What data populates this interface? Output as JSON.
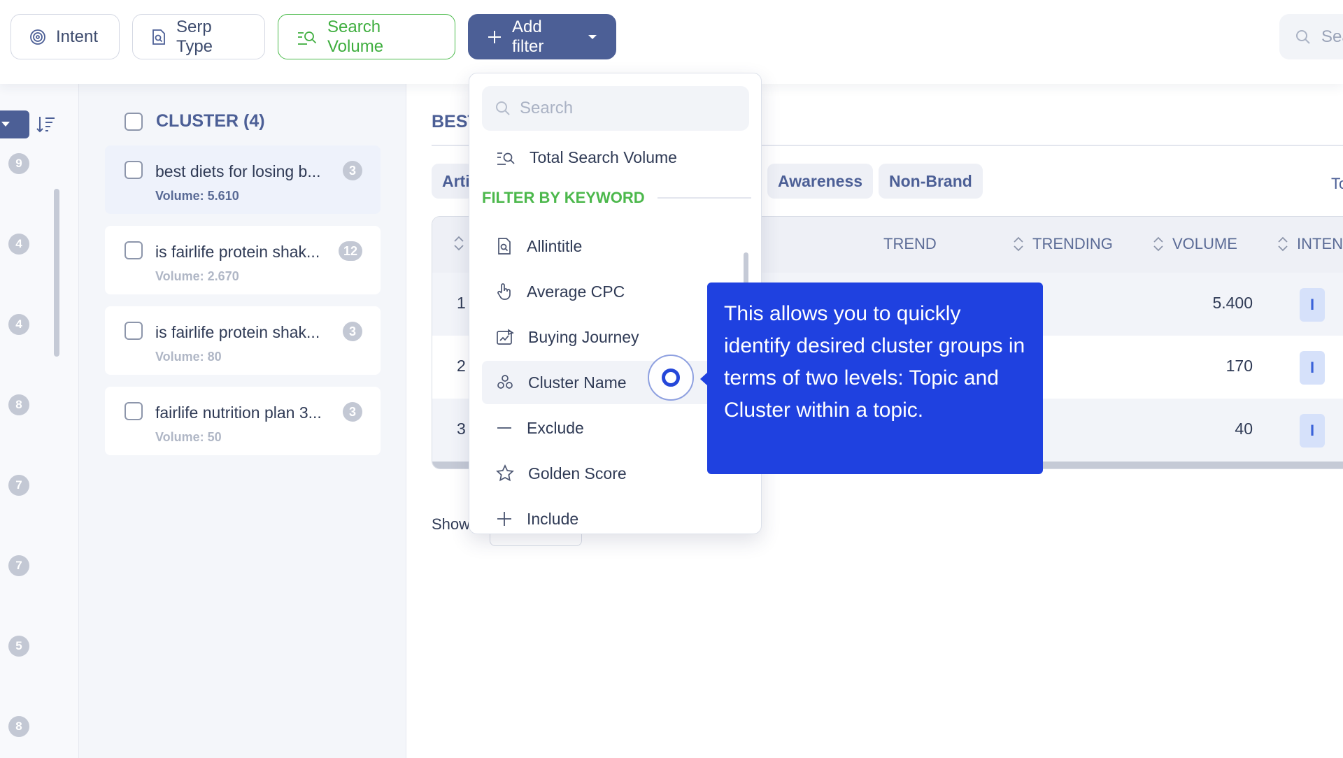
{
  "toolbar": {
    "intent_label": "Intent",
    "serp_type_label": "Serp Type",
    "search_volume_label": "Search Volume",
    "add_filter_label": "Add filter",
    "search_placeholder": "Sea"
  },
  "rail": {
    "numbers": [
      "9",
      "4",
      "4",
      "8",
      "7",
      "7",
      "5",
      "8"
    ]
  },
  "clusters": {
    "header": "CLUSTER (4)",
    "items": [
      {
        "title": "best diets for losing b...",
        "volume": "Volume: 5.610",
        "count": "3"
      },
      {
        "title": "is fairlife protein shak...",
        "volume": "Volume: 2.670",
        "count": "12"
      },
      {
        "title": "is fairlife protein shak...",
        "volume": "Volume: 80",
        "count": "3"
      },
      {
        "title": "fairlife nutrition plan 3...",
        "volume": "Volume: 50",
        "count": "3"
      }
    ]
  },
  "main": {
    "title_fragment": "BEST",
    "pill_left": "Arti",
    "pills": [
      "Awareness",
      "Non-Brand"
    ],
    "right_fragment": "To",
    "table": {
      "headers": {
        "trend": "TREND",
        "trending": "TRENDING",
        "volume": "VOLUME",
        "intent": "INTEN"
      },
      "rows": [
        {
          "num": "1",
          "volume": "5.400",
          "intent": "I"
        },
        {
          "num": "2",
          "volume": "170",
          "intent": "I"
        },
        {
          "num": "3",
          "volume": "40",
          "intent": "I"
        }
      ]
    },
    "show_label": "Show"
  },
  "dropdown": {
    "search_placeholder": "Search",
    "top_item": "Total Search Volume",
    "section_title": "FILTER BY KEYWORD",
    "items": [
      "Allintitle",
      "Average CPC",
      "Buying Journey",
      "Cluster Name",
      "Exclude",
      "Golden Score",
      "Include"
    ]
  },
  "tooltip": {
    "text": "This allows you to quickly identify desired cluster groups in terms of two levels: Topic and Cluster within a topic."
  },
  "colors": {
    "primary": "#4c5f96",
    "green": "#4cbb4c",
    "tooltip": "#1f41e0",
    "badge": "#c3c8d4"
  }
}
